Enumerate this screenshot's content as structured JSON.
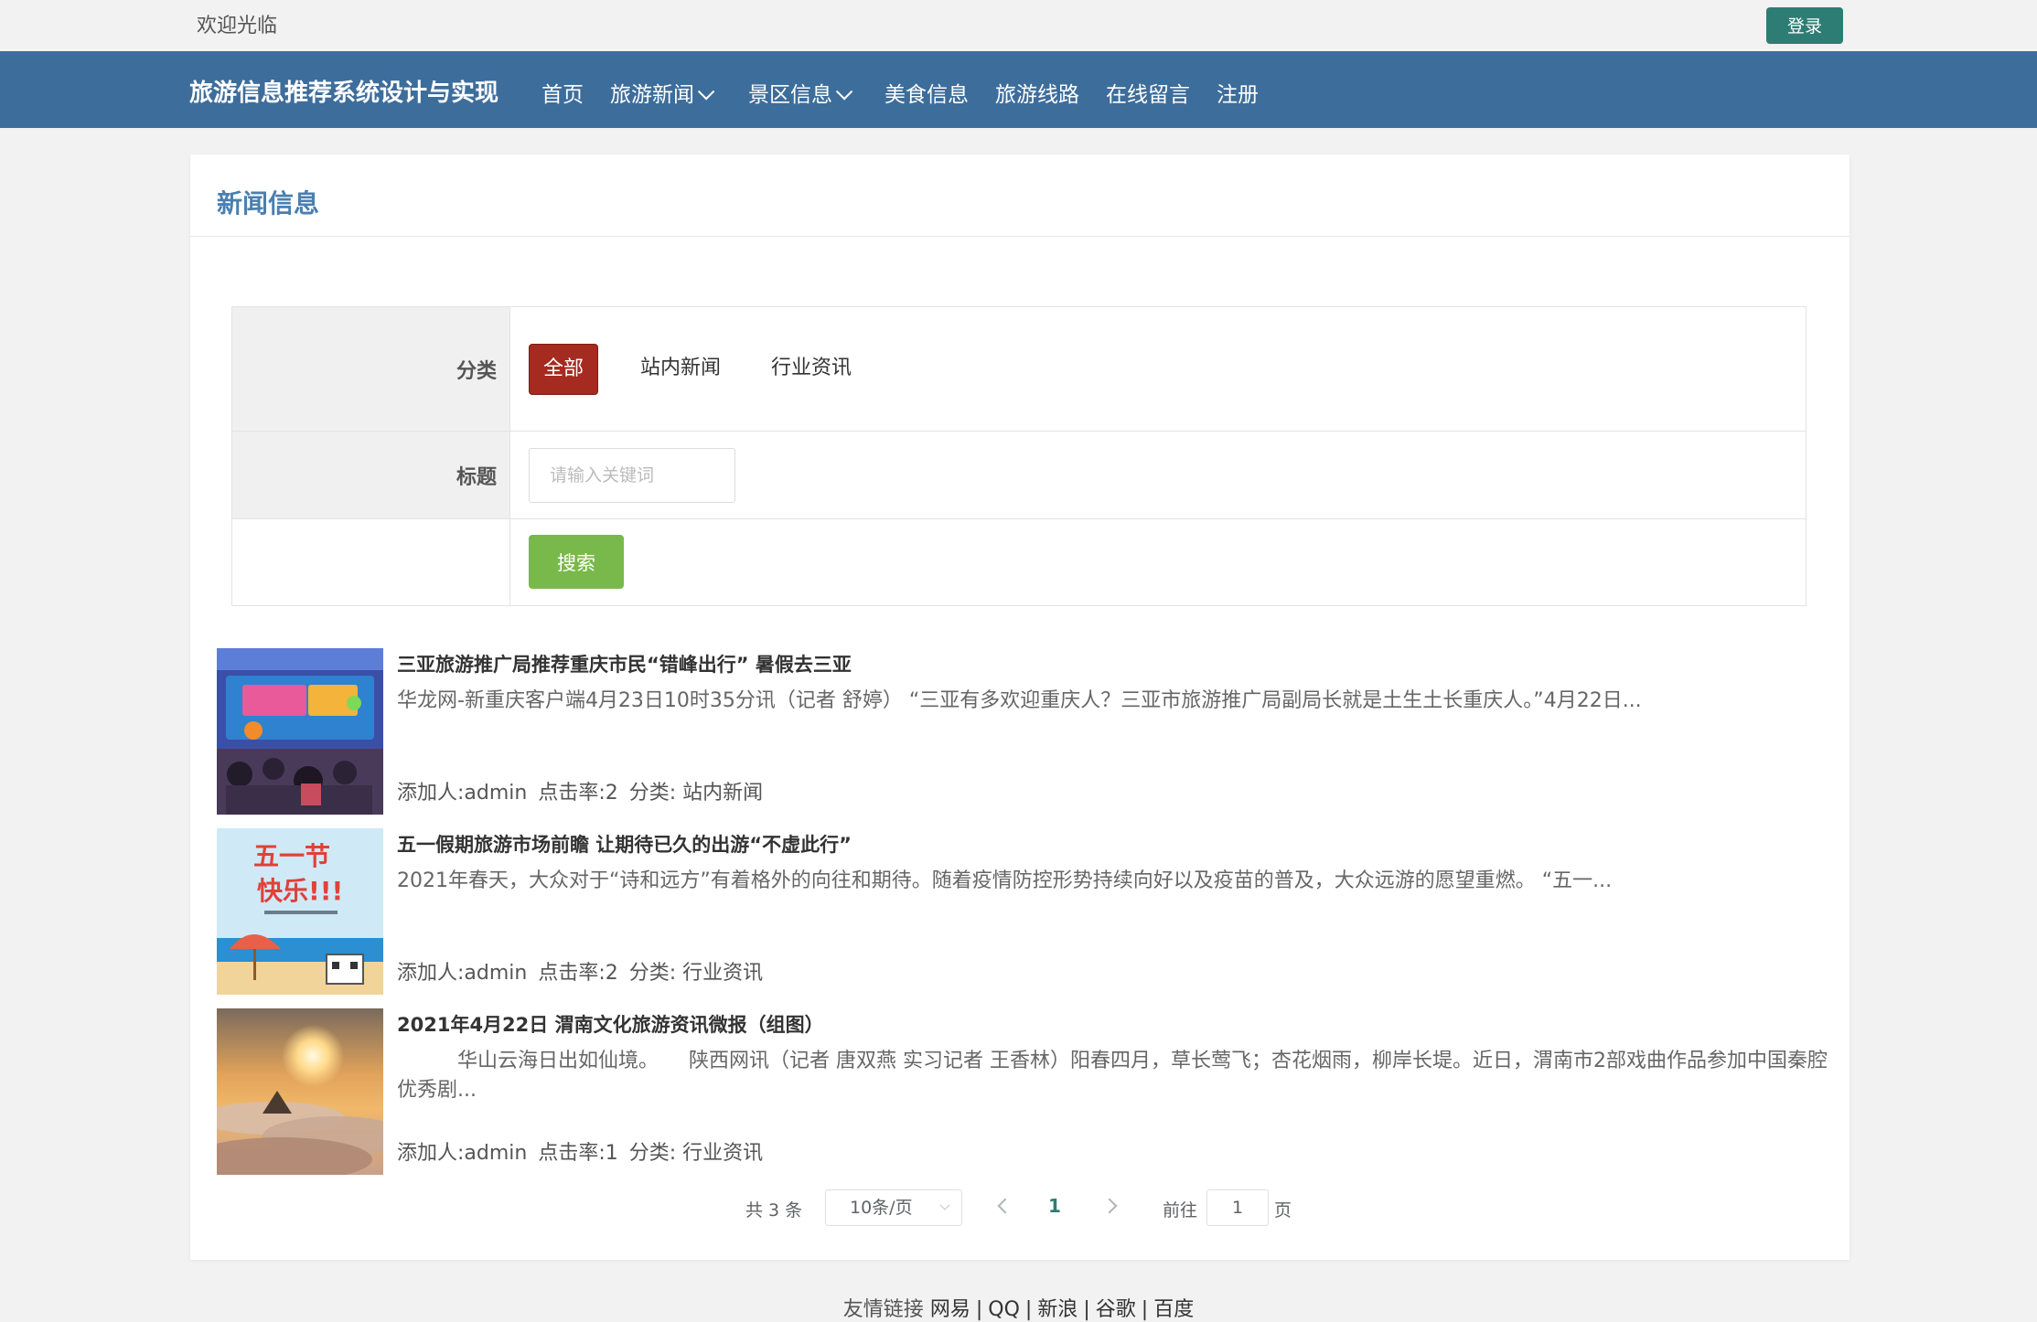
{
  "topbar": {
    "welcome": "欢迎光临",
    "login_label": "登录"
  },
  "nav": {
    "brand": "旅游信息推荐系统设计与实现",
    "items": [
      {
        "label": "首页"
      },
      {
        "label": "旅游新闻"
      },
      {
        "label": "景区信息"
      },
      {
        "label": "美食信息"
      },
      {
        "label": "旅游线路"
      },
      {
        "label": "在线留言"
      },
      {
        "label": "注册"
      }
    ]
  },
  "panel": {
    "title": "新闻信息"
  },
  "filter": {
    "category_label": "分类",
    "categories": [
      {
        "label": "全部",
        "active": true
      },
      {
        "label": "站内新闻",
        "active": false
      },
      {
        "label": "行业资讯",
        "active": false
      }
    ],
    "title_label": "标题",
    "keyword_placeholder": "请输入关键词",
    "search_label": "搜索"
  },
  "news": [
    {
      "title": "三亚旅游推广局推荐重庆市民“错峰出行” 暑假去三亚",
      "summary": "华龙网-新重庆客户端4月23日10时35分讯（记者 舒婷） “三亚有多欢迎重庆人？三亚市旅游推广局副局长就是土生土长重庆人。”4月22日...",
      "author": "添加人:admin",
      "clicks": "点击率:2",
      "category": "分类: 站内新闻"
    },
    {
      "title": "五一假期旅游市场前瞻 让期待已久的出游“不虚此行”",
      "summary": "2021年春天，大众对于“诗和远方”有着格外的向往和期待。随着疫情防控形势持续向好以及疫苗的普及，大众远游的愿望重燃。 “五一...",
      "author": "添加人:admin",
      "clicks": "点击率:2",
      "category": "分类: 行业资讯",
      "thumb_text_1": "五一节",
      "thumb_text_2": "快乐!!!"
    },
    {
      "title": "2021年4月22日 渭南文化旅游资讯微报（组图）",
      "summary": "　　　华山云海日出如仙境。　　陕西网讯（记者 唐双燕 实习记者 王香林）阳春四月，草长莺飞；杏花烟雨，柳岸长堤。近日，渭南市2部戏曲作品参加中国秦腔优秀剧...",
      "author": "添加人:admin",
      "clicks": "点击率:1",
      "category": "分类: 行业资讯"
    }
  ],
  "pagination": {
    "total": "共 3 条",
    "page_size": "10条/页",
    "current_page": "1",
    "goto_label": "前往",
    "goto_value": "1",
    "page_suffix": "页"
  },
  "footer": {
    "label": "友情链接",
    "links": [
      {
        "label": "网易"
      },
      {
        "label": "QQ"
      },
      {
        "label": "新浪"
      },
      {
        "label": "谷歌"
      },
      {
        "label": "百度"
      }
    ]
  },
  "colors": {
    "nav_bg": "#3d6d9b",
    "login_btn": "#2e7d74",
    "active_category": "#a52a1f",
    "search_btn": "#79b94b",
    "title_blue": "#4a7fb0"
  }
}
